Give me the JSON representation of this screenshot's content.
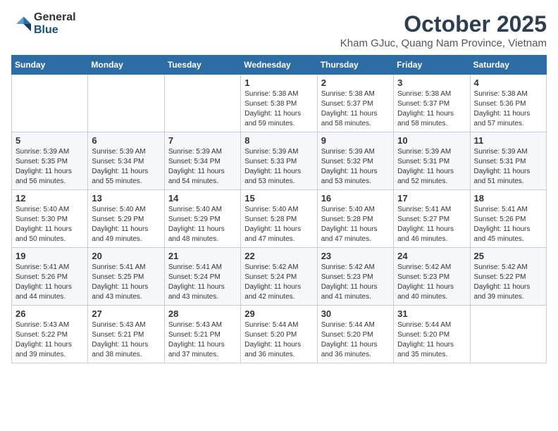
{
  "logo": {
    "line1": "General",
    "line2": "Blue"
  },
  "title": "October 2025",
  "subtitle": "Kham GJuc, Quang Nam Province, Vietnam",
  "days_of_week": [
    "Sunday",
    "Monday",
    "Tuesday",
    "Wednesday",
    "Thursday",
    "Friday",
    "Saturday"
  ],
  "weeks": [
    [
      {
        "day": "",
        "info": ""
      },
      {
        "day": "",
        "info": ""
      },
      {
        "day": "",
        "info": ""
      },
      {
        "day": "1",
        "info": "Sunrise: 5:38 AM\nSunset: 5:38 PM\nDaylight: 11 hours\nand 59 minutes."
      },
      {
        "day": "2",
        "info": "Sunrise: 5:38 AM\nSunset: 5:37 PM\nDaylight: 11 hours\nand 58 minutes."
      },
      {
        "day": "3",
        "info": "Sunrise: 5:38 AM\nSunset: 5:37 PM\nDaylight: 11 hours\nand 58 minutes."
      },
      {
        "day": "4",
        "info": "Sunrise: 5:38 AM\nSunset: 5:36 PM\nDaylight: 11 hours\nand 57 minutes."
      }
    ],
    [
      {
        "day": "5",
        "info": "Sunrise: 5:39 AM\nSunset: 5:35 PM\nDaylight: 11 hours\nand 56 minutes."
      },
      {
        "day": "6",
        "info": "Sunrise: 5:39 AM\nSunset: 5:34 PM\nDaylight: 11 hours\nand 55 minutes."
      },
      {
        "day": "7",
        "info": "Sunrise: 5:39 AM\nSunset: 5:34 PM\nDaylight: 11 hours\nand 54 minutes."
      },
      {
        "day": "8",
        "info": "Sunrise: 5:39 AM\nSunset: 5:33 PM\nDaylight: 11 hours\nand 53 minutes."
      },
      {
        "day": "9",
        "info": "Sunrise: 5:39 AM\nSunset: 5:32 PM\nDaylight: 11 hours\nand 53 minutes."
      },
      {
        "day": "10",
        "info": "Sunrise: 5:39 AM\nSunset: 5:31 PM\nDaylight: 11 hours\nand 52 minutes."
      },
      {
        "day": "11",
        "info": "Sunrise: 5:39 AM\nSunset: 5:31 PM\nDaylight: 11 hours\nand 51 minutes."
      }
    ],
    [
      {
        "day": "12",
        "info": "Sunrise: 5:40 AM\nSunset: 5:30 PM\nDaylight: 11 hours\nand 50 minutes."
      },
      {
        "day": "13",
        "info": "Sunrise: 5:40 AM\nSunset: 5:29 PM\nDaylight: 11 hours\nand 49 minutes."
      },
      {
        "day": "14",
        "info": "Sunrise: 5:40 AM\nSunset: 5:29 PM\nDaylight: 11 hours\nand 48 minutes."
      },
      {
        "day": "15",
        "info": "Sunrise: 5:40 AM\nSunset: 5:28 PM\nDaylight: 11 hours\nand 47 minutes."
      },
      {
        "day": "16",
        "info": "Sunrise: 5:40 AM\nSunset: 5:28 PM\nDaylight: 11 hours\nand 47 minutes."
      },
      {
        "day": "17",
        "info": "Sunrise: 5:41 AM\nSunset: 5:27 PM\nDaylight: 11 hours\nand 46 minutes."
      },
      {
        "day": "18",
        "info": "Sunrise: 5:41 AM\nSunset: 5:26 PM\nDaylight: 11 hours\nand 45 minutes."
      }
    ],
    [
      {
        "day": "19",
        "info": "Sunrise: 5:41 AM\nSunset: 5:26 PM\nDaylight: 11 hours\nand 44 minutes."
      },
      {
        "day": "20",
        "info": "Sunrise: 5:41 AM\nSunset: 5:25 PM\nDaylight: 11 hours\nand 43 minutes."
      },
      {
        "day": "21",
        "info": "Sunrise: 5:41 AM\nSunset: 5:24 PM\nDaylight: 11 hours\nand 43 minutes."
      },
      {
        "day": "22",
        "info": "Sunrise: 5:42 AM\nSunset: 5:24 PM\nDaylight: 11 hours\nand 42 minutes."
      },
      {
        "day": "23",
        "info": "Sunrise: 5:42 AM\nSunset: 5:23 PM\nDaylight: 11 hours\nand 41 minutes."
      },
      {
        "day": "24",
        "info": "Sunrise: 5:42 AM\nSunset: 5:23 PM\nDaylight: 11 hours\nand 40 minutes."
      },
      {
        "day": "25",
        "info": "Sunrise: 5:42 AM\nSunset: 5:22 PM\nDaylight: 11 hours\nand 39 minutes."
      }
    ],
    [
      {
        "day": "26",
        "info": "Sunrise: 5:43 AM\nSunset: 5:22 PM\nDaylight: 11 hours\nand 39 minutes."
      },
      {
        "day": "27",
        "info": "Sunrise: 5:43 AM\nSunset: 5:21 PM\nDaylight: 11 hours\nand 38 minutes."
      },
      {
        "day": "28",
        "info": "Sunrise: 5:43 AM\nSunset: 5:21 PM\nDaylight: 11 hours\nand 37 minutes."
      },
      {
        "day": "29",
        "info": "Sunrise: 5:44 AM\nSunset: 5:20 PM\nDaylight: 11 hours\nand 36 minutes."
      },
      {
        "day": "30",
        "info": "Sunrise: 5:44 AM\nSunset: 5:20 PM\nDaylight: 11 hours\nand 36 minutes."
      },
      {
        "day": "31",
        "info": "Sunrise: 5:44 AM\nSunset: 5:20 PM\nDaylight: 11 hours\nand 35 minutes."
      },
      {
        "day": "",
        "info": ""
      }
    ]
  ]
}
